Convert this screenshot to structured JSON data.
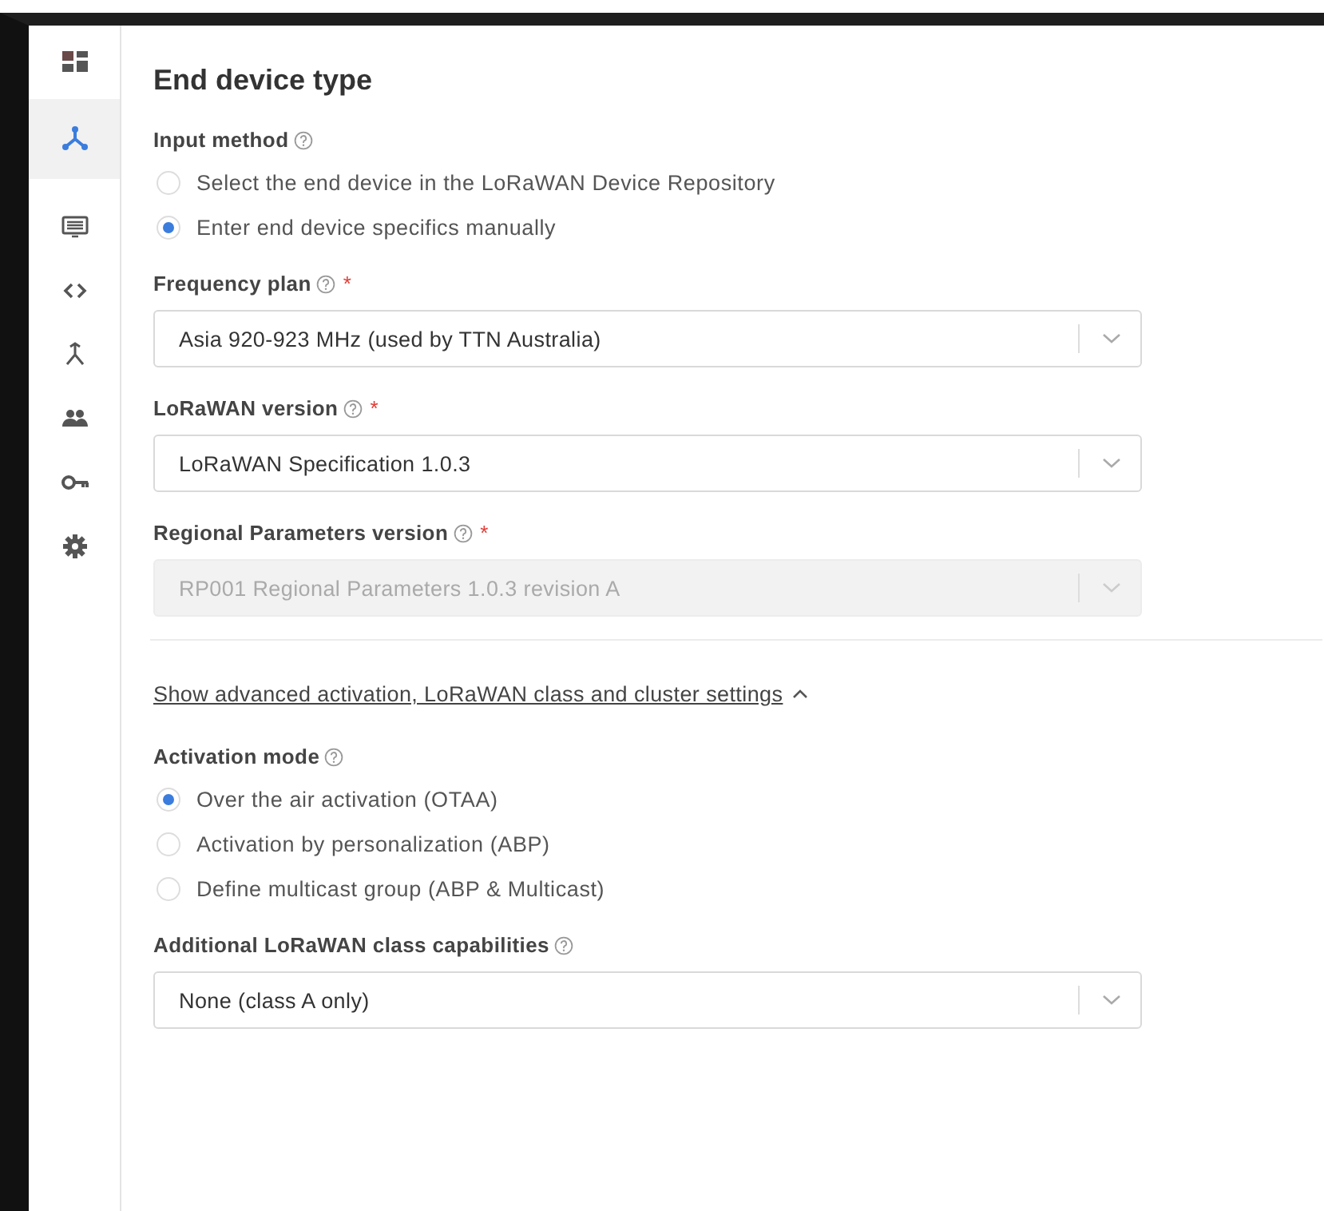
{
  "sidebar": {
    "items": [
      {
        "selected": false
      },
      {
        "selected": true
      },
      {
        "selected": false
      },
      {
        "selected": false
      },
      {
        "selected": false
      },
      {
        "selected": false
      },
      {
        "selected": false
      },
      {
        "selected": false
      }
    ]
  },
  "title": "End device type",
  "form": [
    {
      "kind": "radio_group",
      "label": "Input method",
      "help": true,
      "options": [
        {
          "label": "Select the end device in the LoRaWAN Device Repository",
          "selected": false
        },
        {
          "label": "Enter end device specifics manually",
          "selected": true
        }
      ]
    },
    {
      "kind": "select",
      "label": "Frequency plan",
      "help": true,
      "required_mark": "*",
      "value": "Asia 920-923 MHz (used by TTN Australia)",
      "disabled": false
    },
    {
      "kind": "select",
      "label": "LoRaWAN version",
      "help": true,
      "required_mark": "*",
      "value": "LoRaWAN Specification 1.0.3",
      "disabled": false
    },
    {
      "kind": "select",
      "label": "Regional Parameters version",
      "help": true,
      "required_mark": "*",
      "value": "RP001 Regional Parameters 1.0.3 revision A",
      "disabled": true
    },
    {
      "kind": "link",
      "text": "Show advanced activation, LoRaWAN class and cluster settings",
      "expanded": true
    },
    {
      "kind": "radio_group",
      "label": "Activation mode",
      "help": true,
      "options": [
        {
          "label": "Over the air activation (OTAA)",
          "selected": true
        },
        {
          "label": "Activation by personalization (ABP)",
          "selected": false
        },
        {
          "label": "Define multicast group (ABP & Multicast)",
          "selected": false
        }
      ]
    },
    {
      "kind": "select",
      "label": "Additional LoRaWAN class capabilities",
      "help": true,
      "value": "None (class A only)",
      "disabled": false
    }
  ]
}
